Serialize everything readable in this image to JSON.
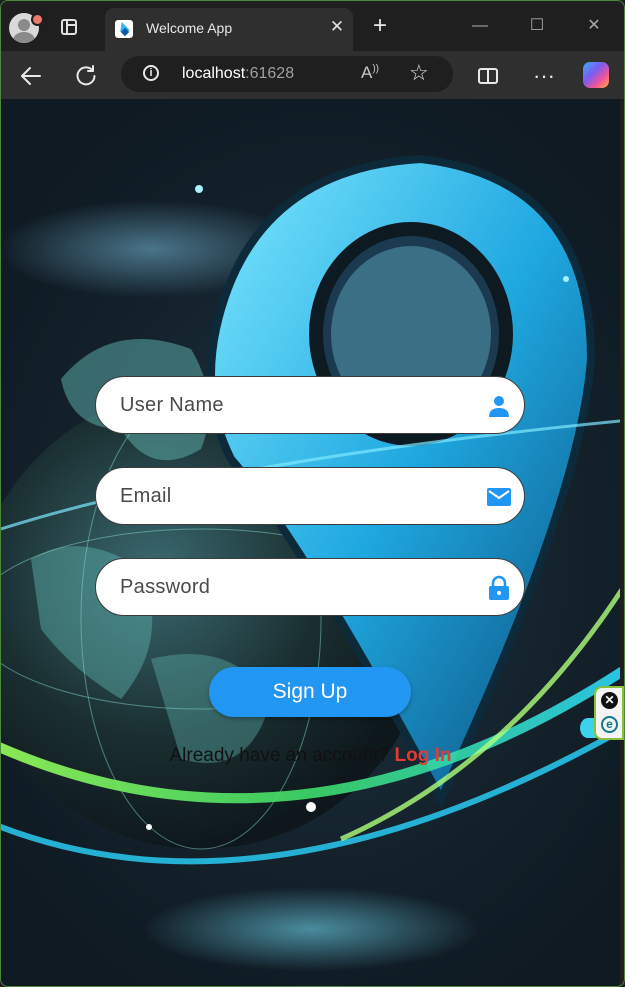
{
  "browser": {
    "tab_title": "Welcome App",
    "url_host": "localhost",
    "url_port": ":61628",
    "icons": [
      "profile-avatar",
      "tab-actions-icon",
      "flutter-favicon",
      "close-icon",
      "plus-icon",
      "minimize-icon",
      "maximize-icon",
      "window-close-icon",
      "back-arrow-icon",
      "refresh-icon",
      "info-icon",
      "read-aloud-icon",
      "star-icon",
      "split-screen-icon",
      "more-icon",
      "copilot-icon"
    ]
  },
  "form": {
    "username_placeholder": "User Name",
    "email_placeholder": "Email",
    "password_placeholder": "Password",
    "signup_label": "Sign Up",
    "already_text": "Already have an account? ",
    "login_link": "Log In"
  },
  "colors": {
    "primary": "#2196f3",
    "link": "#e53935",
    "icon": "#2196f3"
  }
}
